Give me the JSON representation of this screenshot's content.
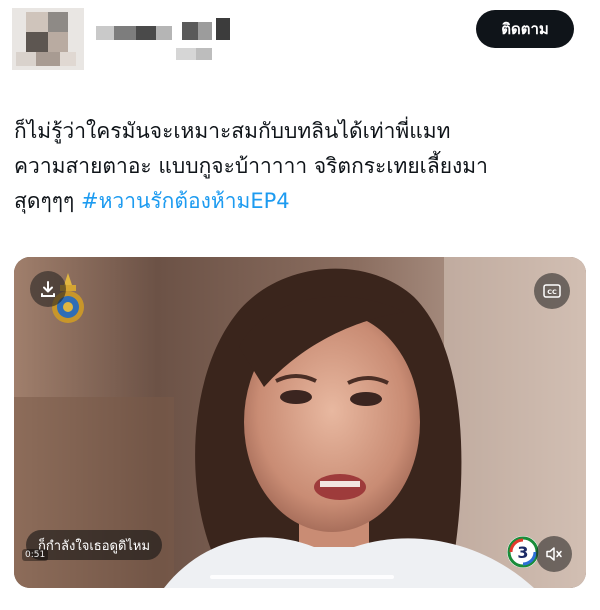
{
  "header": {
    "follow_label": "ติดตาม"
  },
  "tweet": {
    "lines": [
      "ก็ไม่รู้ว่าใครมันจะเหมาะสมกับบทลินได้เท่าพี่แมท",
      "ความสายตาอะ แบบกูจะบ้าาาาา จริตกระเทยเลี้ยงมา"
    ],
    "last_line_text": "สุดๆๆๆ ",
    "hashtag": "#หวานรักต้องห้ามEP4"
  },
  "media": {
    "caption": "ก็กำลังใจเธอดูดิไหม",
    "time": "0:51",
    "download_icon": "download-icon",
    "cc_icon": "cc-icon",
    "mute_icon": "speaker-muted-icon",
    "channel_logo": "channel-3-logo",
    "emblem": "royal-emblem-logo"
  },
  "colors": {
    "accent": "#1d9bf0",
    "button": "#0f1419",
    "text": "#0f1419"
  }
}
